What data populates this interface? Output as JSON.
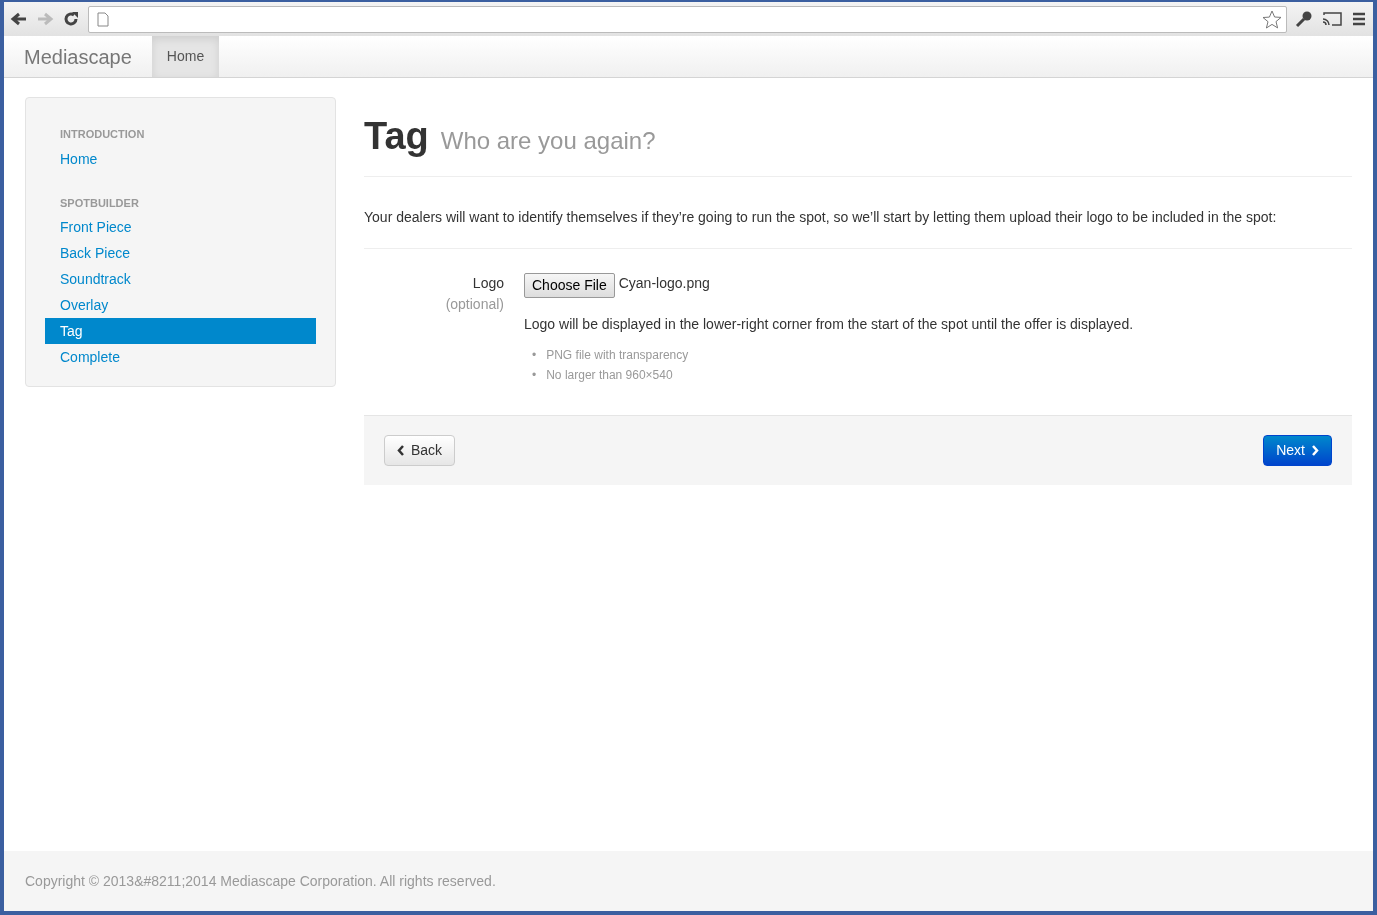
{
  "navbar": {
    "brand": "Mediascape",
    "items": [
      {
        "label": "Home",
        "selected": true
      }
    ]
  },
  "sidebar": {
    "sections": [
      {
        "heading": "INTRODUCTION",
        "items": [
          {
            "label": "Home",
            "selected": false
          }
        ]
      },
      {
        "heading": "SPOTBUILDER",
        "items": [
          {
            "label": "Front Piece",
            "selected": false
          },
          {
            "label": "Back Piece",
            "selected": false
          },
          {
            "label": "Soundtrack",
            "selected": false
          },
          {
            "label": "Overlay",
            "selected": false
          },
          {
            "label": "Tag",
            "selected": true
          },
          {
            "label": "Complete",
            "selected": false
          }
        ]
      }
    ]
  },
  "page": {
    "title": "Tag",
    "subtitle": "Who are you again?",
    "intro": "Your dealers will want to identify themselves if they’re going to run the spot, so we’ll start by letting them upload their logo to be included in the spot:"
  },
  "form": {
    "label": "Logo",
    "hint": "(optional)",
    "file_button": "Choose File",
    "file_name": "Cyan-logo.png",
    "help": "Logo will be displayed in the lower-right corner from the start of the spot until the offer is displayed.",
    "requirements": [
      {
        "marker": "•",
        "text": "PNG file with transparency"
      },
      {
        "marker": "•",
        "text": "No larger than 960×540"
      }
    ]
  },
  "actions": {
    "back": "Back",
    "next": "Next"
  },
  "footer": {
    "text": "Copyright © 2013&#8211;2014 Mediascape Corporation. All rights reserved."
  }
}
